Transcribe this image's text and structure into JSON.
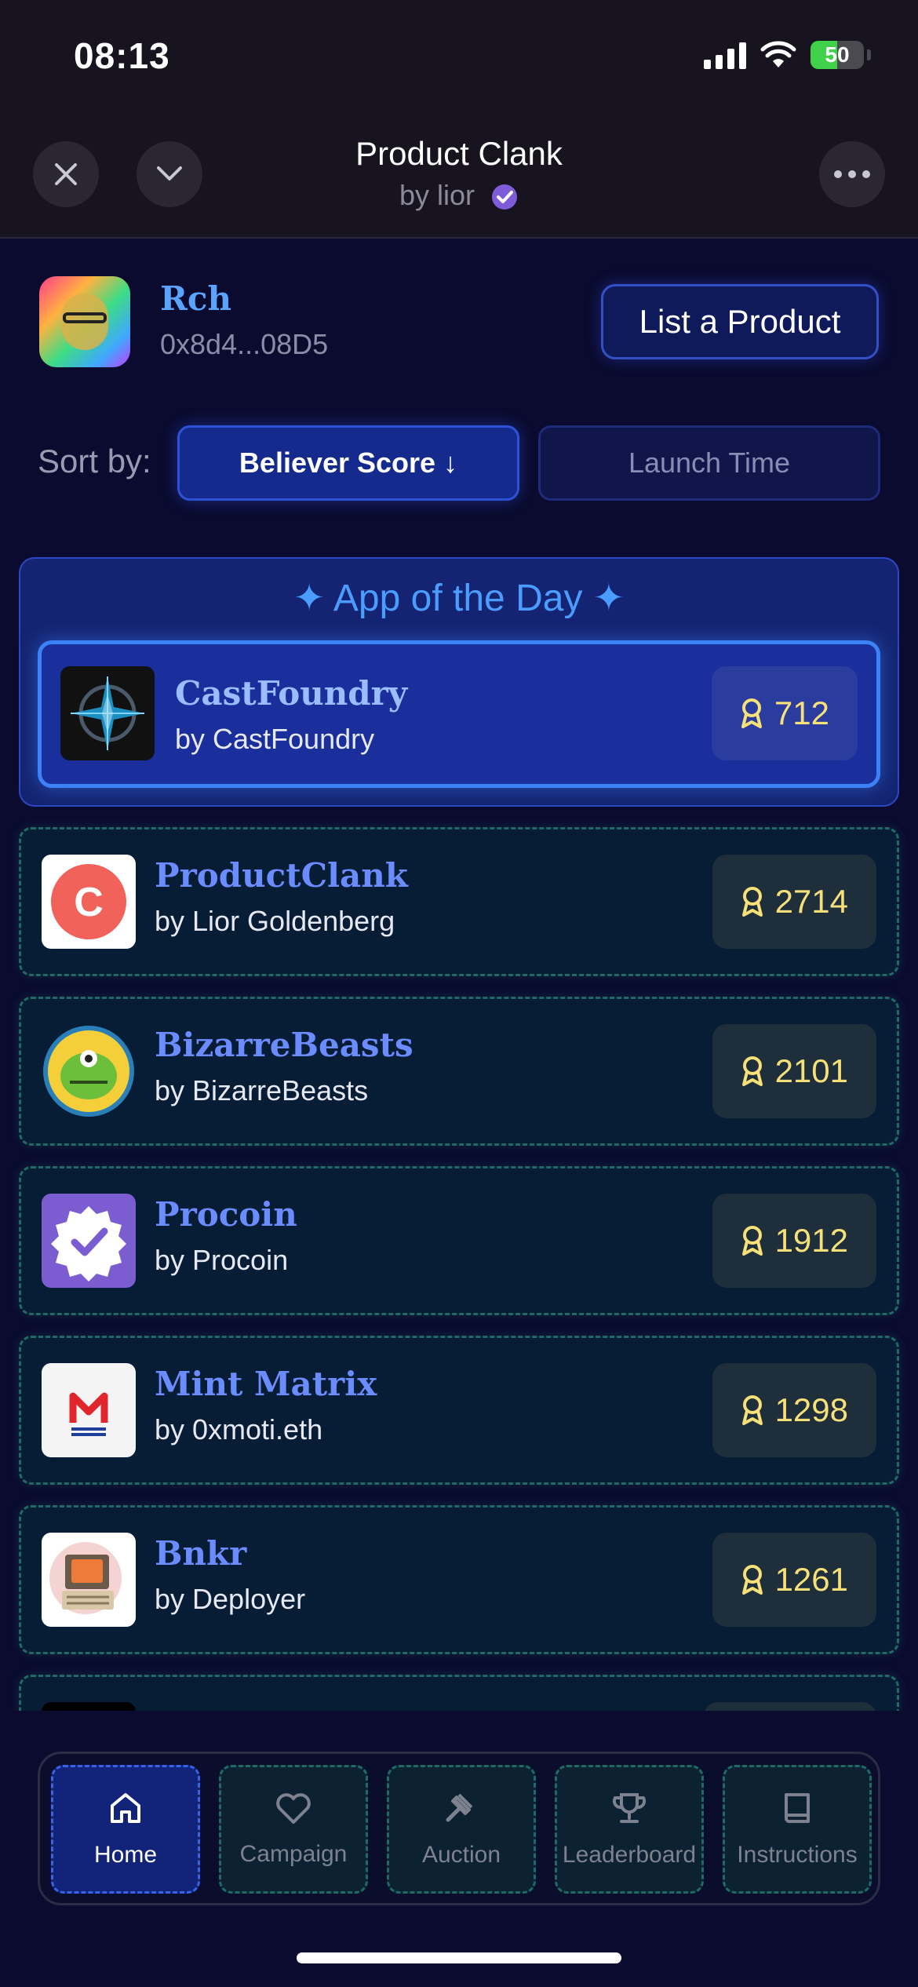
{
  "status_bar": {
    "time": "08:13",
    "battery": "50"
  },
  "header": {
    "title": "Product Clank",
    "subtitle": "by lior"
  },
  "profile": {
    "username": "Rch",
    "address": "0x8d4...08D5",
    "list_button": "List a Product"
  },
  "sort": {
    "label": "Sort by:",
    "active": "Believer Score ↓",
    "inactive": "Launch Time"
  },
  "app_of_the_day": {
    "title": "✦ App of the Day ✦",
    "item": {
      "name": "CastFoundry",
      "by": "by CastFoundry",
      "score": "712"
    }
  },
  "products": [
    {
      "name": "ProductClank",
      "by": "by Lior Goldenberg",
      "score": "2714"
    },
    {
      "name": "BizarreBeasts",
      "by": "by BizarreBeasts",
      "score": "2101"
    },
    {
      "name": "Procoin",
      "by": "by Procoin",
      "score": "1912"
    },
    {
      "name": "Mint Matrix",
      "by": "by 0xmoti.eth",
      "score": "1298"
    },
    {
      "name": "Bnkr",
      "by": "by Deployer",
      "score": "1261"
    }
  ],
  "nav": {
    "items": [
      {
        "label": "Home",
        "icon": "home-icon"
      },
      {
        "label": "Campaign",
        "icon": "heart-icon"
      },
      {
        "label": "Auction",
        "icon": "gavel-icon"
      },
      {
        "label": "Leaderboard",
        "icon": "trophy-icon"
      },
      {
        "label": "Instructions",
        "icon": "book-icon"
      }
    ]
  },
  "colors": {
    "accent": "#3b82f6",
    "score_text": "#f6e07a",
    "name_text": "#6b8cff",
    "background": "#0a0b2e"
  }
}
